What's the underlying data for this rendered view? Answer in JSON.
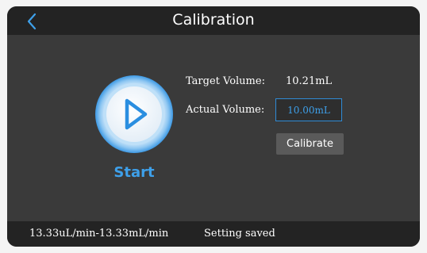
{
  "header": {
    "title": "Calibration",
    "back_icon": "chevron-left-icon"
  },
  "start": {
    "label": "Start",
    "icon": "play-icon"
  },
  "form": {
    "target_label": "Target Volume:",
    "target_value": "10.21mL",
    "actual_label": "Actual Volume:",
    "actual_value": "10.00mL",
    "calibrate_label": "Calibrate"
  },
  "status": {
    "flow_range": "13.33uL/min-13.33mL/min",
    "message": "Setting saved"
  },
  "colors": {
    "accent": "#3ea0ea",
    "background": "#3a3a3a",
    "bar": "#232323",
    "button": "#5a5a5a"
  }
}
